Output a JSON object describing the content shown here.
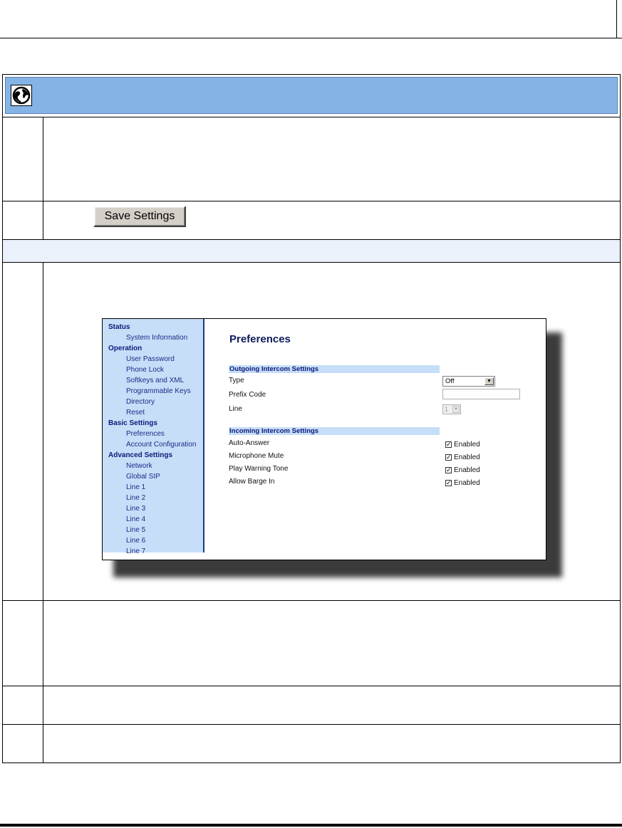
{
  "save_button": {
    "label": "Save Settings"
  },
  "web_ui": {
    "sidebar": [
      {
        "type": "head",
        "label": "Status"
      },
      {
        "type": "item",
        "label": "System Information"
      },
      {
        "type": "head",
        "label": "Operation"
      },
      {
        "type": "item",
        "label": "User Password"
      },
      {
        "type": "item",
        "label": "Phone Lock"
      },
      {
        "type": "item",
        "label": "Softkeys and XML"
      },
      {
        "type": "item",
        "label": "Programmable Keys"
      },
      {
        "type": "item",
        "label": "Directory"
      },
      {
        "type": "item",
        "label": "Reset"
      },
      {
        "type": "head",
        "label": "Basic Settings"
      },
      {
        "type": "item",
        "label": "Preferences"
      },
      {
        "type": "item",
        "label": "Account Configuration"
      },
      {
        "type": "head",
        "label": "Advanced Settings"
      },
      {
        "type": "item",
        "label": "Network"
      },
      {
        "type": "item",
        "label": "Global SIP"
      },
      {
        "type": "item",
        "label": "Line 1"
      },
      {
        "type": "item",
        "label": "Line 2"
      },
      {
        "type": "item",
        "label": "Line 3"
      },
      {
        "type": "item",
        "label": "Line 4"
      },
      {
        "type": "item",
        "label": "Line 5"
      },
      {
        "type": "item",
        "label": "Line 6"
      },
      {
        "type": "item",
        "label": "Line 7"
      }
    ],
    "title": "Preferences",
    "outgoing": {
      "heading": "Outgoing Intercom Settings",
      "type_label": "Type",
      "type_value": "Off",
      "prefix_label": "Prefix Code",
      "prefix_value": "",
      "line_label": "Line",
      "line_value": "1"
    },
    "incoming": {
      "heading": "Incoming Intercom Settings",
      "options": [
        {
          "label": "Auto-Answer",
          "checked": true,
          "value_label": "Enabled"
        },
        {
          "label": "Microphone Mute",
          "checked": true,
          "value_label": "Enabled"
        },
        {
          "label": "Play Warning Tone",
          "checked": true,
          "value_label": "Enabled"
        },
        {
          "label": "Allow Barge In",
          "checked": true,
          "value_label": "Enabled"
        }
      ]
    }
  }
}
